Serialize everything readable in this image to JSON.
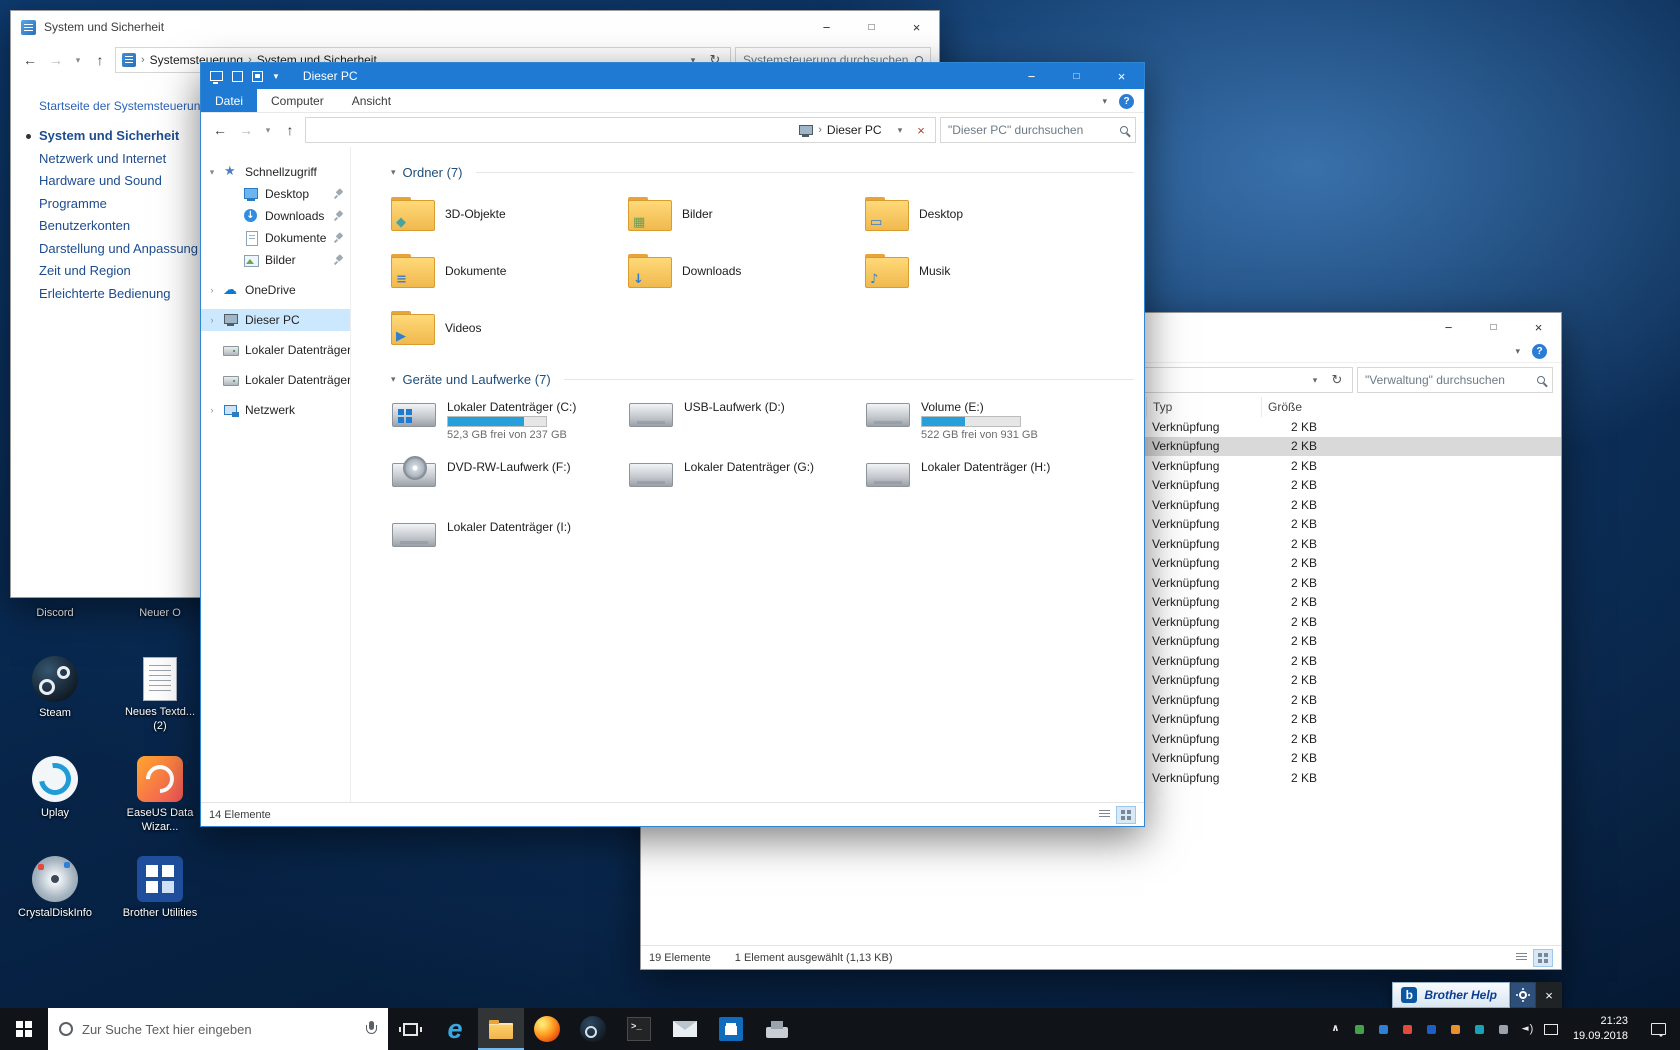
{
  "control_panel": {
    "title": "System und Sicherheit",
    "crumbs": [
      {
        "label": "Systemsteuerung"
      },
      {
        "label": "System und Sicherheit"
      }
    ],
    "search_placeholder": "Systemsteuerung durchsuchen",
    "sidebar_home": "Startseite der Systemsteuerung",
    "sidebar_items": [
      {
        "label": "System und Sicherheit",
        "active": "active",
        "bullet": "yes"
      },
      {
        "label": "Netzwerk und Internet"
      },
      {
        "label": "Hardware und Sound"
      },
      {
        "label": "Programme"
      },
      {
        "label": "Benutzerkonten"
      },
      {
        "label": "Darstellung und Anpassung"
      },
      {
        "label": "Zeit und Region"
      },
      {
        "label": "Erleichterte Bedienung"
      }
    ]
  },
  "explorer": {
    "title": "Dieser PC",
    "tabs": [
      {
        "label": "Datei",
        "cls": "datei"
      },
      {
        "label": "Computer"
      },
      {
        "label": "Ansicht"
      }
    ],
    "crumbs": [
      {
        "label": "Dieser PC"
      }
    ],
    "address_progress": "width:78%",
    "search_placeholder": "\"Dieser PC\" durchsuchen",
    "nav_quick_access": "Schnellzugriff",
    "nav_quick_items": [
      {
        "label": "Desktop",
        "icon": "desktop"
      },
      {
        "label": "Downloads",
        "icon": "downloads"
      },
      {
        "label": "Dokumente",
        "icon": "documents"
      },
      {
        "label": "Bilder",
        "icon": "pictures"
      }
    ],
    "nav_roots": [
      {
        "label": "OneDrive",
        "icon": "onedrive",
        "chev": "yes"
      },
      {
        "label": "Dieser PC",
        "icon": "pc",
        "chev": "yes",
        "selected": "selected"
      },
      {
        "label": "Lokaler Datenträger (",
        "icon": "drive"
      },
      {
        "label": "Lokaler Datenträger (",
        "icon": "drive"
      },
      {
        "label": "Netzwerk",
        "icon": "network",
        "chev": "yes"
      }
    ],
    "group_folders": "Ordner (7)",
    "folders": [
      {
        "label": "3D-Objekte",
        "glyph": "◆",
        "color": "#46a3a0"
      },
      {
        "label": "Bilder",
        "glyph": "▦",
        "color": "#6b9e57"
      },
      {
        "label": "Desktop",
        "glyph": "▭",
        "color": "#2f7fd0"
      },
      {
        "label": "Dokumente",
        "glyph": "≡",
        "color": "#4d7fc0"
      },
      {
        "label": "Downloads",
        "glyph": "↓",
        "color": "#2f7fd0"
      },
      {
        "label": "Musik",
        "glyph": "♪",
        "color": "#2f7fd0"
      },
      {
        "label": "Videos",
        "glyph": "▶",
        "color": "#2f7fd0"
      }
    ],
    "group_drives": "Geräte und Laufwerke (7)",
    "drives": [
      {
        "label": "Lokaler Datenträger (C:)",
        "kind": "windows",
        "fill": "78%",
        "detail": "52,3 GB frei von 237 GB"
      },
      {
        "label": "USB-Laufwerk (D:)",
        "kind": "usb"
      },
      {
        "label": "Volume (E:)",
        "kind": "plain",
        "fill": "44%",
        "detail": "522 GB frei von 931 GB"
      },
      {
        "label": "DVD-RW-Laufwerk (F:)",
        "kind": "dvd"
      },
      {
        "label": "Lokaler Datenträger (G:)",
        "kind": "plain"
      },
      {
        "label": "Lokaler Datenträger (H:)",
        "kind": "plain"
      },
      {
        "label": "Lokaler Datenträger (I:)",
        "kind": "plain"
      }
    ],
    "status": "14 Elemente"
  },
  "admin": {
    "search_placeholder": "\"Verwaltung\" durchsuchen",
    "columns": {
      "typ": "Typ",
      "groesse": "Größe"
    },
    "rows": [
      {
        "typ": "Verknüpfung",
        "size": "2 KB"
      },
      {
        "typ": "Verknüpfung",
        "size": "2 KB",
        "selected": "selected"
      },
      {
        "typ": "Verknüpfung",
        "size": "2 KB"
      },
      {
        "typ": "Verknüpfung",
        "size": "2 KB"
      },
      {
        "typ": "Verknüpfung",
        "size": "2 KB"
      },
      {
        "typ": "Verknüpfung",
        "size": "2 KB"
      },
      {
        "typ": "Verknüpfung",
        "size": "2 KB"
      },
      {
        "typ": "Verknüpfung",
        "size": "2 KB"
      },
      {
        "typ": "Verknüpfung",
        "size": "2 KB"
      },
      {
        "typ": "Verknüpfung",
        "size": "2 KB"
      },
      {
        "typ": "Verknüpfung",
        "size": "2 KB"
      },
      {
        "typ": "Verknüpfung",
        "size": "2 KB"
      },
      {
        "typ": "Verknüpfung",
        "size": "2 KB"
      },
      {
        "typ": "Verknüpfung",
        "size": "2 KB"
      },
      {
        "typ": "Verknüpfung",
        "size": "2 KB"
      },
      {
        "typ": "Verknüpfung",
        "size": "2 KB"
      },
      {
        "typ": "Verknüpfung",
        "size": "2 KB"
      },
      {
        "typ": "Verknüpfung",
        "size": "2 KB"
      },
      {
        "typ": "Verknüpfung",
        "size": "2 KB"
      }
    ],
    "status_count": "19 Elemente",
    "status_selected": "1 Element ausgewählt (1,13 KB)"
  },
  "brother": {
    "logo_letter": "b",
    "label": "Brother Help"
  },
  "desktop": {
    "col1": [
      {
        "label": "Discord",
        "kind": "hidden"
      },
      {
        "label": "Steam",
        "kind": "steam"
      },
      {
        "label": "Uplay",
        "kind": "uplay"
      },
      {
        "label": "CrystalDiskInfo",
        "kind": "crystal"
      }
    ],
    "col2": [
      {
        "label": "Neuer O",
        "kind": "hidden"
      },
      {
        "label": "Neues Textd...\n(2)",
        "kind": "textdoc"
      },
      {
        "label": "EaseUS Data\nWizar...",
        "kind": "easeus"
      },
      {
        "label": "Brother Utilities",
        "kind": "brotherutil"
      }
    ]
  },
  "taskbar": {
    "search_placeholder": "Zur Suche Text hier eingeben",
    "apps": [
      {
        "name": "edge"
      },
      {
        "name": "file-explorer",
        "state": "active"
      },
      {
        "name": "firefox"
      },
      {
        "name": "steam"
      },
      {
        "name": "cmd"
      },
      {
        "name": "mail"
      },
      {
        "name": "store"
      },
      {
        "name": "printer"
      }
    ],
    "tray": [
      {
        "kind": "chevron"
      },
      {
        "kind": "app",
        "color": "#46a049"
      },
      {
        "kind": "app",
        "color": "#2f7fd8"
      },
      {
        "kind": "app",
        "color": "#e24a3b"
      },
      {
        "kind": "app",
        "color": "#1d5fc4"
      },
      {
        "kind": "app",
        "color": "#e8912d"
      },
      {
        "kind": "app",
        "color": "#17a2b8"
      },
      {
        "kind": "app",
        "color": "#9aa2ab"
      },
      {
        "kind": "volume"
      },
      {
        "kind": "network"
      }
    ],
    "clock_time": "21:23",
    "clock_date": "19.09.2018"
  }
}
